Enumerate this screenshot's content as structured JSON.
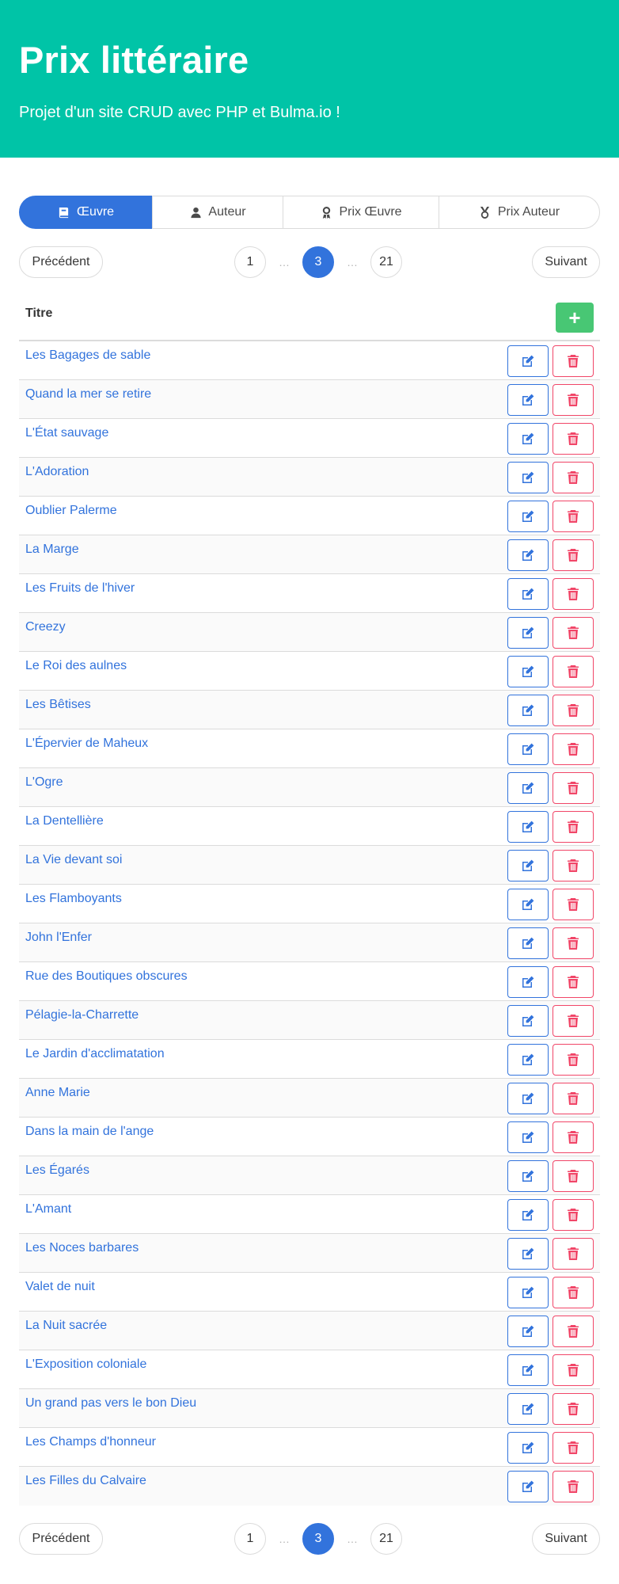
{
  "hero": {
    "title": "Prix littéraire",
    "subtitle": "Projet d'un site CRUD avec PHP et Bulma.io !"
  },
  "tabs": [
    {
      "label": "Œuvre",
      "icon": "book-icon",
      "active": true
    },
    {
      "label": "Auteur",
      "icon": "user-icon",
      "active": false
    },
    {
      "label": "Prix Œuvre",
      "icon": "award-icon",
      "active": false
    },
    {
      "label": "Prix Auteur",
      "icon": "medal-icon",
      "active": false
    }
  ],
  "pagination": {
    "prev_label": "Précédent",
    "next_label": "Suivant",
    "first": "1",
    "current": "3",
    "last": "21",
    "ellipsis": "…"
  },
  "table": {
    "header": "Titre",
    "add_label": "+",
    "rows": [
      "Les Bagages de sable",
      "Quand la mer se retire",
      "L'État sauvage",
      "L'Adoration",
      "Oublier Palerme",
      "La Marge",
      "Les Fruits de l'hiver",
      "Creezy",
      "Le Roi des aulnes",
      "Les Bêtises",
      "L'Épervier de Maheux",
      "L'Ogre",
      "La Dentellière",
      "La Vie devant soi",
      "Les Flamboyants",
      "John l'Enfer",
      "Rue des Boutiques obscures",
      "Pélagie-la-Charrette",
      "Le Jardin d'acclimatation",
      "Anne Marie",
      "Dans la main de l'ange",
      "Les Égarés",
      "L'Amant",
      "Les Noces barbares",
      "Valet de nuit",
      "La Nuit sacrée",
      "L'Exposition coloniale",
      "Un grand pas vers le bon Dieu",
      "Les Champs d'honneur",
      "Les Filles du Calvaire"
    ]
  },
  "colors": {
    "hero": "#00c4a7",
    "primary": "#3273dc",
    "success": "#48c774",
    "danger": "#f14668"
  }
}
